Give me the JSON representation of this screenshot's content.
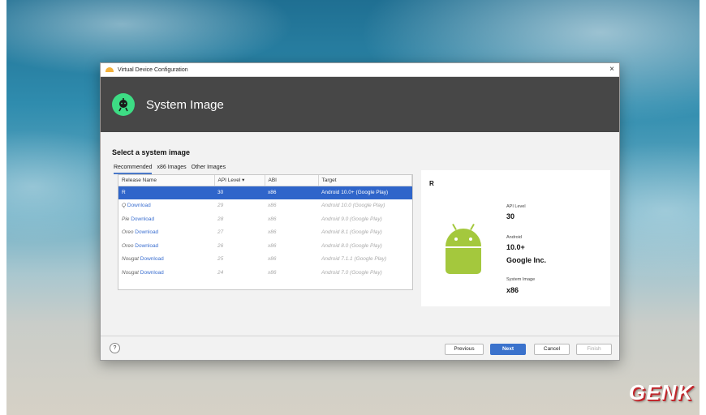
{
  "window": {
    "title": "Virtual Device Configuration",
    "close_glyph": "×"
  },
  "header": {
    "title": "System Image"
  },
  "main": {
    "section_title": "Select a system image",
    "tabs": [
      {
        "label": "Recommended",
        "active": true
      },
      {
        "label": "x86 Images",
        "active": false
      },
      {
        "label": "Other Images",
        "active": false
      }
    ],
    "columns": [
      "Release Name",
      "API Level ▾",
      "ABI",
      "Target"
    ],
    "rows": [
      {
        "release": "R",
        "download": "",
        "api": "30",
        "abi": "x86",
        "target": "Android 10.0+ (Google Play)",
        "selected": true
      },
      {
        "release": "Q",
        "download": "Download",
        "api": "29",
        "abi": "x86",
        "target": "Android 10.0 (Google Play)",
        "selected": false
      },
      {
        "release": "Pie",
        "download": "Download",
        "api": "28",
        "abi": "x86",
        "target": "Android 9.0 (Google Play)",
        "selected": false
      },
      {
        "release": "Oreo",
        "download": "Download",
        "api": "27",
        "abi": "x86",
        "target": "Android 8.1 (Google Play)",
        "selected": false
      },
      {
        "release": "Oreo",
        "download": "Download",
        "api": "26",
        "abi": "x86",
        "target": "Android 8.0 (Google Play)",
        "selected": false
      },
      {
        "release": "Nougat",
        "download": "Download",
        "api": "25",
        "abi": "x86",
        "target": "Android 7.1.1 (Google Play)",
        "selected": false
      },
      {
        "release": "Nougat",
        "download": "Download",
        "api": "24",
        "abi": "x86",
        "target": "Android 7.0 (Google Play)",
        "selected": false
      }
    ]
  },
  "detail": {
    "title": "R",
    "api_label": "API Level",
    "api_value": "30",
    "android_label": "Android",
    "android_value": "10.0+",
    "vendor": "Google Inc.",
    "sysimg_label": "System Image",
    "sysimg_value": "x86"
  },
  "footer": {
    "help": "?",
    "previous": "Previous",
    "next": "Next",
    "cancel": "Cancel",
    "finish": "Finish"
  },
  "watermark": "GENK",
  "colors": {
    "accent": "#3a72cc",
    "header_bg": "#474747",
    "android_green": "#a4c83d",
    "logo_green": "#3ddc84"
  }
}
